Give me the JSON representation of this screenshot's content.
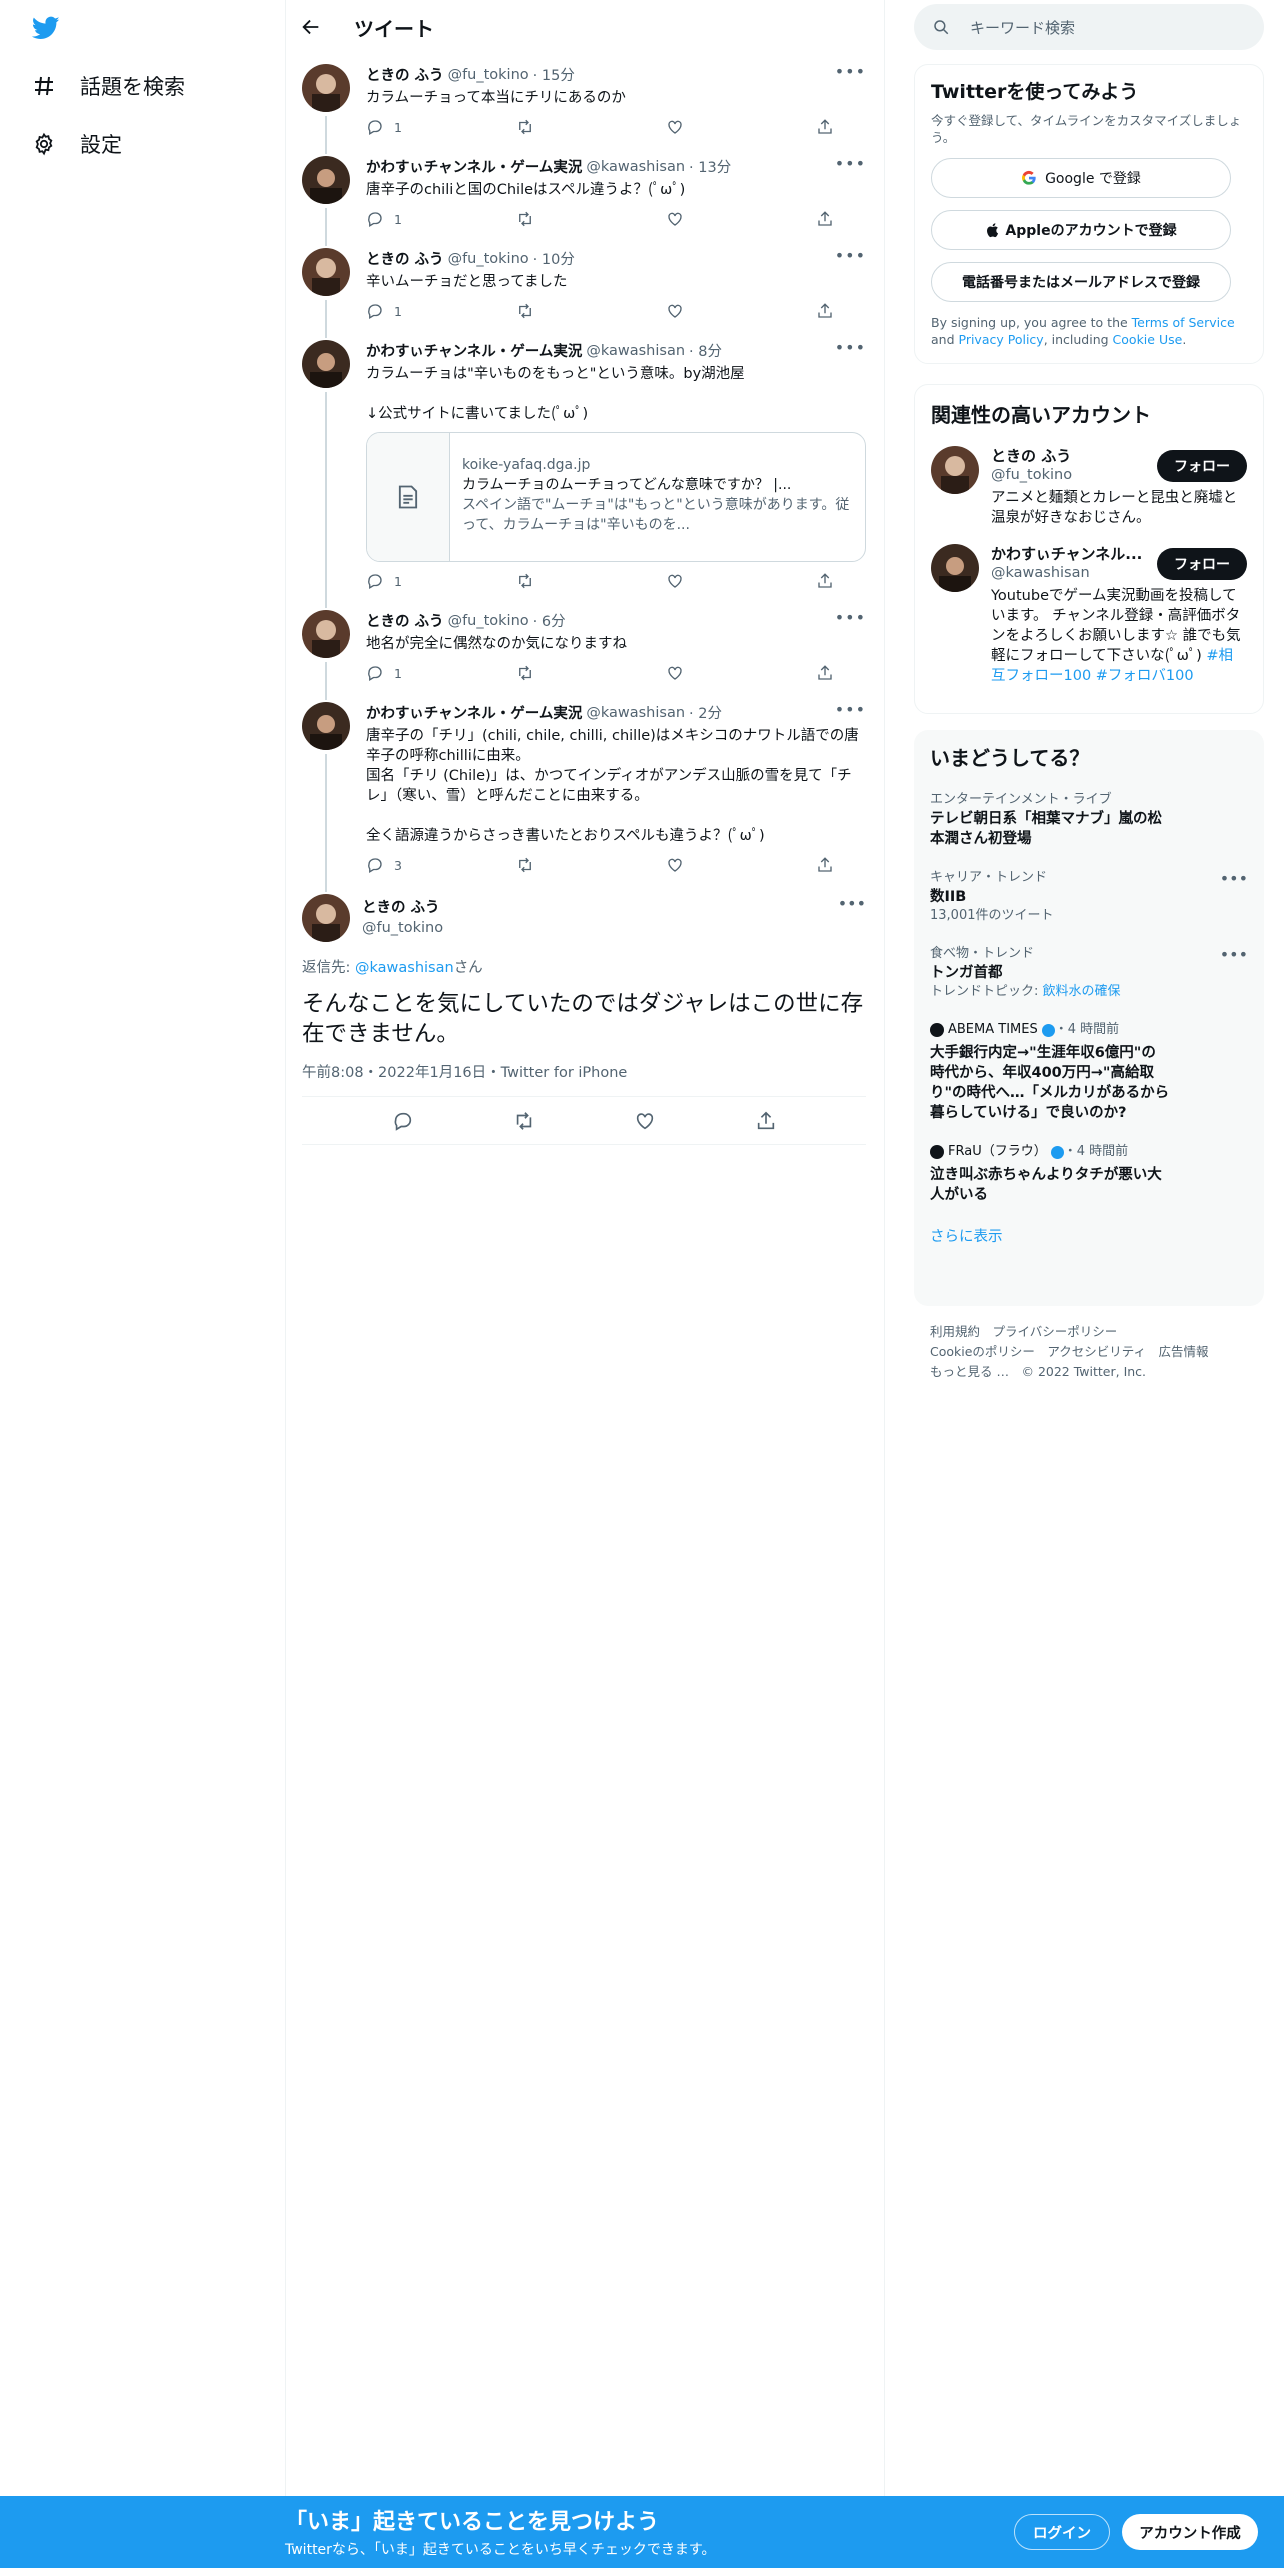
{
  "left": {
    "nav": [
      {
        "label": "話題を検索",
        "icon": "hashtag-icon"
      },
      {
        "label": "設定",
        "icon": "gear-icon"
      }
    ]
  },
  "header": {
    "title": "ツイート"
  },
  "thread": [
    {
      "name": "ときの ふう",
      "handle": "@fu_tokino",
      "age": "15分",
      "text": "カラムーチョって本当にチリにあるのか",
      "replies": "1"
    },
    {
      "name": "かわすぃチャンネル・ゲーム実況",
      "handle": "@kawashisan",
      "age": "13分",
      "text": "唐辛子のchiliと国のChileはスペル違うよ？(ﾟωﾟ)",
      "replies": "1"
    },
    {
      "name": "ときの ふう",
      "handle": "@fu_tokino",
      "age": "10分",
      "text": "辛いムーチョだと思ってました",
      "replies": "1"
    },
    {
      "name": "かわすぃチャンネル・ゲーム実況",
      "handle": "@kawashisan",
      "age": "8分",
      "text": "カラムーチョは\"辛いものをもっと\"という意味。by湖池屋\n\n↓公式サイトに書いてました(ﾟωﾟ)",
      "replies": "1",
      "card": {
        "domain": "koike-yafaq.dga.jp",
        "title": "カラムーチョのムーチョってどんな意味ですか？ |...",
        "desc": "スペイン語で\"ムーチョ\"は\"もっと\"という意味があります。従って、カラムーチョは\"辛いものを..."
      }
    },
    {
      "name": "ときの ふう",
      "handle": "@fu_tokino",
      "age": "6分",
      "text": "地名が完全に偶然なのか気になりますね",
      "replies": "1"
    },
    {
      "name": "かわすぃチャンネル・ゲーム実況",
      "handle": "@kawashisan",
      "age": "2分",
      "text": "唐辛子の「チリ」(chili, chile, chilli, chille)はメキシコのナワトル語での唐辛子の呼称chilliに由来。\n国名「チリ (Chile)」は、かつてインディオがアンデス山脈の雪を見て「チレ」（寒い、雪）と呼んだことに由来する。\n\n全く語源違うからさっき書いたとおりスペルも違うよ？(ﾟωﾟ)",
      "replies": "3"
    }
  ],
  "main_tweet": {
    "name": "ときの ふう",
    "handle": "@fu_tokino",
    "reply_prefix": "返信先: ",
    "reply_handle": "@kawashisan",
    "reply_suffix": "さん",
    "text": "そんなことを気にしていたのではダジャレはこの世に存在できません。",
    "meta": "午前8:08・2022年1月16日・Twitter for iPhone"
  },
  "right": {
    "search_placeholder": "キーワード検索",
    "signup": {
      "title": "Twitterを使ってみよう",
      "sub": "今すぐ登録して、タイムラインをカスタマイズしましょう。",
      "google": "Google で登録",
      "apple": "Appleのアカウントで登録",
      "phone": "電話番号またはメールアドレスで登録",
      "terms_pre": "By signing up, you agree to the ",
      "terms": "Terms of Service",
      "and": " and ",
      "privacy": "Privacy Policy",
      "including": ", including ",
      "cookie": "Cookie Use",
      "dot": "."
    },
    "related": {
      "title": "関連性の高いアカウント",
      "follow": "フォロー",
      "accounts": [
        {
          "name": "ときの ふう",
          "handle": "@fu_tokino",
          "bio": "アニメと麺類とカレーと昆虫と廃墟と温泉が好きなおじさん。"
        },
        {
          "name": "かわすぃチャンネル...",
          "handle": "@kawashisan",
          "bio": "Youtubeでゲーム実況動画を投稿しています。 チャンネル登録・高評価ボタンをよろしくお願いします☆ 誰でも気軽にフォローして下さいな(ﾟωﾟ) ",
          "tags": "#相互フォロー100 #フォロバ100"
        }
      ]
    },
    "trends": {
      "title": "いまどうしてる？",
      "items": [
        {
          "cat": "エンターテインメント・ライブ",
          "text": "テレビ朝日系「相葉マナブ」嵐の松本潤さん初登場"
        },
        {
          "cat": "キャリア・トレンド",
          "text": "数IIB",
          "note": "13,001件のツイート"
        },
        {
          "cat": "食べ物・トレンド",
          "text": "トンガ首都",
          "note_pre": "トレンドトピック: ",
          "note_link": "飲料水の確保"
        },
        {
          "source": "ABEMA TIMES",
          "age": "・4 時間前",
          "text": "大手銀行内定→\"生涯年収6億円\"の時代から、年収400万円→\"高給取り\"の時代へ…「メルカリがあるから暮らしていける」で良いのか?"
        },
        {
          "source": "FRaU（フラウ）",
          "age": "・4 時間前",
          "text": "泣き叫ぶ赤ちゃんよりタチが悪い大人がいる"
        }
      ],
      "more": "さらに表示"
    },
    "footer": {
      "line1": "利用規約　プライバシーポリシー",
      "line2": "Cookieのポリシー　アクセシビリティ　広告情報",
      "line3": "もっと見る …　© 2022 Twitter, Inc."
    }
  },
  "banner": {
    "title": "「いま」起きていることを見つけよう",
    "sub": "Twitterなら、「いま」起きていることをいち早くチェックできます。",
    "login": "ログイン",
    "signup": "アカウント作成"
  },
  "colors": {
    "accent": "#1d9bf0",
    "text": "#0f1419",
    "muted": "#536471"
  }
}
